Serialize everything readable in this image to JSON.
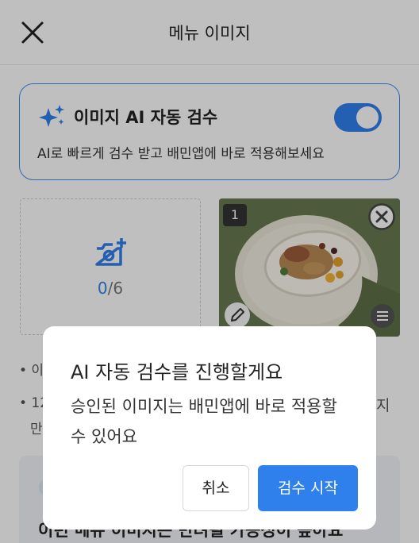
{
  "header": {
    "title": "메뉴 이미지",
    "close_icon": "close-icon"
  },
  "ai_review": {
    "title": "이미지 AI 자동 검수",
    "description": "AI로 빠르게 검수 받고 배민앱에 바로 적용해보세요",
    "icon": "sparkle-icon",
    "toggle_on": true,
    "accent_color": "#2f80ed"
  },
  "upload": {
    "current": "0",
    "separator": "/",
    "total": "6",
    "icon": "camera-add-icon"
  },
  "photo": {
    "badge": "1",
    "remove_icon": "close-circle-icon",
    "edit_icon": "pencil-icon",
    "menu_icon": "menu-icon"
  },
  "background": {
    "bullet1": "• 이",
    "bullet2_line1": "• 12",
    "bullet2_line2": "만",
    "bullet2_right": "지",
    "tip": "이런 메뉴 이미지는 반려될 가능성이 높아요"
  },
  "dialog": {
    "title": "AI 자동 검수를 진행할게요",
    "message": "승인된 이미지는 배민앱에 바로 적용할 수 있어요",
    "cancel_label": "취소",
    "confirm_label": "검수 시작"
  }
}
